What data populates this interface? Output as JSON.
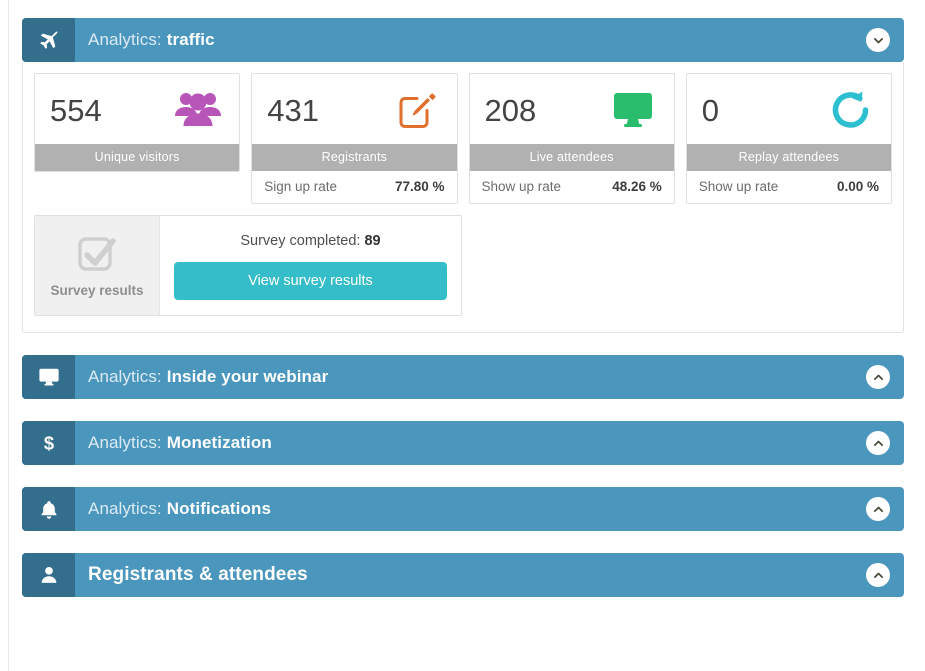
{
  "sections": [
    {
      "id": "traffic",
      "icon": "airplane-icon",
      "lead": "Analytics:",
      "strong": "traffic",
      "expanded": true,
      "toggle": "chevron-down-icon"
    },
    {
      "id": "inside-your-webinar",
      "icon": "monitor-icon",
      "lead": "Analytics:",
      "strong": "Inside your webinar",
      "expanded": false,
      "toggle": "chevron-up-icon"
    },
    {
      "id": "monetization",
      "icon": "dollar-icon",
      "lead": "Analytics:",
      "strong": "Monetization",
      "expanded": false,
      "toggle": "chevron-up-icon"
    },
    {
      "id": "notifications",
      "icon": "bell-icon",
      "lead": "Analytics:",
      "strong": "Notifications",
      "expanded": false,
      "toggle": "chevron-up-icon"
    },
    {
      "id": "registrants-attendees",
      "icon": "user-icon",
      "lead": "",
      "strong": "Registrants & attendees",
      "expanded": false,
      "toggle": "chevron-up-icon"
    }
  ],
  "traffic": {
    "cards": [
      {
        "value": "554",
        "label": "Unique visitors",
        "icon": "users-group-icon",
        "icon_color": "#b855b8",
        "has_footer": false,
        "foot_label": "",
        "foot_value": ""
      },
      {
        "value": "431",
        "label": "Registrants",
        "icon": "edit-pencil-icon",
        "icon_color": "#e1702e",
        "has_footer": true,
        "foot_label": "Sign up rate",
        "foot_value": "77.80 %"
      },
      {
        "value": "208",
        "label": "Live attendees",
        "icon": "monitor-screen-icon",
        "icon_color": "#2bbd6e",
        "has_footer": true,
        "foot_label": "Show up rate",
        "foot_value": "48.26 %"
      },
      {
        "value": "0",
        "label": "Replay attendees",
        "icon": "replay-arrow-icon",
        "icon_color": "#2cbfcf",
        "has_footer": true,
        "foot_label": "Show up rate",
        "foot_value": "0.00 %"
      }
    ],
    "survey": {
      "icon": "checkbox-check-icon",
      "caption": "Survey results",
      "completed_label": "Survey completed:",
      "completed_count": "89",
      "button_label": "View survey results"
    }
  },
  "colors": {
    "header_bar": "#4a96bd",
    "header_icon_tab": "#336e8c",
    "label_band": "#b1b1b1",
    "teal_button": "#35bdc9"
  }
}
